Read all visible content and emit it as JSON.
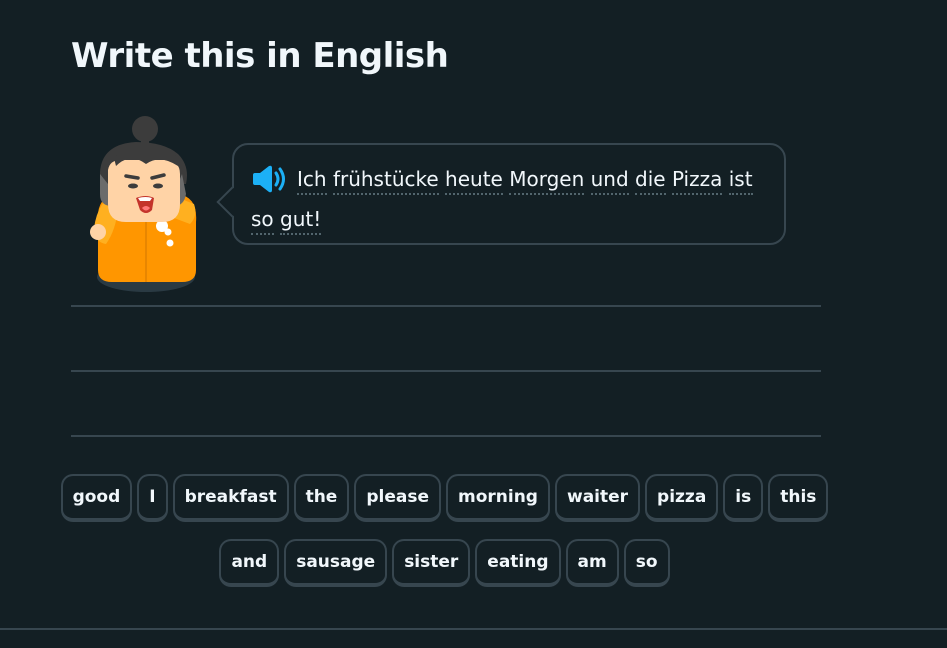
{
  "challenge": {
    "title": "Write this in English"
  },
  "prompt": {
    "words": [
      "Ich",
      "frühstücke",
      "heute",
      "Morgen",
      "und",
      "die",
      "Pizza",
      "ist",
      "so",
      "gut!"
    ],
    "speaker_icon": "speaker-icon"
  },
  "word_bank": {
    "row1": [
      "good",
      "I",
      "breakfast",
      "the",
      "please",
      "morning",
      "waiter",
      "pizza",
      "is",
      "this"
    ],
    "row2": [
      "and",
      "sausage",
      "sister",
      "eating",
      "am",
      "so"
    ]
  },
  "colors": {
    "background": "#131f24",
    "border": "#37464f",
    "text": "#f1f7fb",
    "speaker": "#1cb0f6"
  }
}
